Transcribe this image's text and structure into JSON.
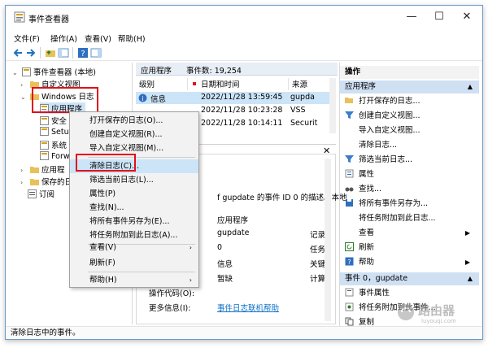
{
  "window": {
    "title": "事件查看器",
    "controls": {
      "minimize": "—",
      "maximize": "☐",
      "close": "✕"
    }
  },
  "menu": [
    "文件(F)",
    "操作(A)",
    "查看(V)",
    "帮助(H)"
  ],
  "tree": {
    "root": "事件查看器 (本地)",
    "custom_views": "自定义视图",
    "windows_logs": "Windows 日志",
    "application": "应用程序",
    "security": "安全",
    "setup": "Setu",
    "system": "系统",
    "forwarded": "Forw",
    "apps_services": "应用程",
    "saved_logs": "保存的日",
    "subscriptions": "订阅"
  },
  "center": {
    "header_name": "应用程序",
    "header_count": "事件数: 19,254",
    "columns": [
      "级别",
      "日期和时间",
      "来源"
    ],
    "rows": [
      {
        "level": "信息",
        "datetime": "2022/11/28 13:59:45",
        "source": "gupda"
      },
      {
        "level": "",
        "datetime": "2022/11/28 10:23:28",
        "source": "VSS"
      },
      {
        "level": "",
        "datetime": "2022/11/28 10:14:11",
        "source": "Securit"
      }
    ],
    "detail_desc": "f gupdate 的事件 ID 0 的描述。本地",
    "detail_values": [
      "应用程序",
      "gupdate",
      "0",
      "信息",
      "暂缺"
    ],
    "detail_side": [
      "记录",
      "任务",
      "关键",
      "计算"
    ],
    "opcode_label": "操作代码(O):",
    "more_info_label": "更多信息(I):",
    "more_info_link": "事件日志联机帮助"
  },
  "context_menu": [
    "打开保存的日志(O)...",
    "创建自定义视图(R)...",
    "导入自定义视图(M)...",
    "清除日志(C)...",
    "筛选当前日志(L)...",
    "属性(P)",
    "查找(N)...",
    "将所有事件另存为(E)...",
    "将任务附加到此日志(A)...",
    "查看(V)",
    "刷新(F)",
    "帮助(H)"
  ],
  "actions": {
    "title": "操作",
    "section1": "应用程序",
    "items1": [
      "打开保存的日志...",
      "创建自定义视图...",
      "导入自定义视图...",
      "清除日志...",
      "筛选当前日志...",
      "属性",
      "查找...",
      "将所有事件另存为...",
      "将任务附加到此日志...",
      "查看",
      "刷新",
      "帮助"
    ],
    "section2": "事件 0，gupdate",
    "items2": [
      "事件属性",
      "将任务附加到此事件...",
      "复制"
    ]
  },
  "status": "清除日志中的事件。",
  "watermark": {
    "text": "路由器",
    "sub": "luyouqi.com"
  },
  "colors": {
    "accent": "#0b6fc6",
    "highlight": "#cce4f7",
    "red": "#e0101a"
  }
}
